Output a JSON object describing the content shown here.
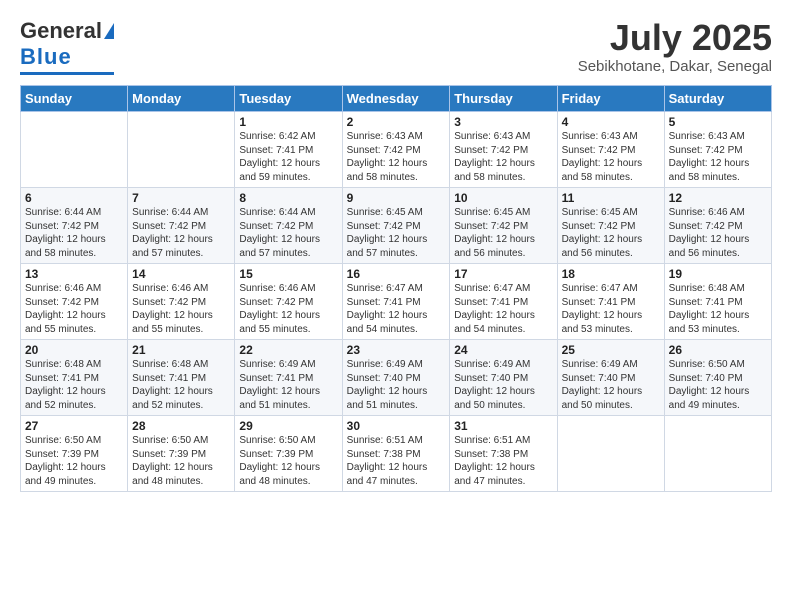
{
  "header": {
    "logo_general": "General",
    "logo_blue": "Blue",
    "month_title": "July 2025",
    "location": "Sebikhotane, Dakar, Senegal"
  },
  "days_of_week": [
    "Sunday",
    "Monday",
    "Tuesday",
    "Wednesday",
    "Thursday",
    "Friday",
    "Saturday"
  ],
  "weeks": [
    [
      {
        "day": "",
        "sunrise": "",
        "sunset": "",
        "daylight": ""
      },
      {
        "day": "",
        "sunrise": "",
        "sunset": "",
        "daylight": ""
      },
      {
        "day": "1",
        "sunrise": "Sunrise: 6:42 AM",
        "sunset": "Sunset: 7:41 PM",
        "daylight": "Daylight: 12 hours and 59 minutes."
      },
      {
        "day": "2",
        "sunrise": "Sunrise: 6:43 AM",
        "sunset": "Sunset: 7:42 PM",
        "daylight": "Daylight: 12 hours and 58 minutes."
      },
      {
        "day": "3",
        "sunrise": "Sunrise: 6:43 AM",
        "sunset": "Sunset: 7:42 PM",
        "daylight": "Daylight: 12 hours and 58 minutes."
      },
      {
        "day": "4",
        "sunrise": "Sunrise: 6:43 AM",
        "sunset": "Sunset: 7:42 PM",
        "daylight": "Daylight: 12 hours and 58 minutes."
      },
      {
        "day": "5",
        "sunrise": "Sunrise: 6:43 AM",
        "sunset": "Sunset: 7:42 PM",
        "daylight": "Daylight: 12 hours and 58 minutes."
      }
    ],
    [
      {
        "day": "6",
        "sunrise": "Sunrise: 6:44 AM",
        "sunset": "Sunset: 7:42 PM",
        "daylight": "Daylight: 12 hours and 58 minutes."
      },
      {
        "day": "7",
        "sunrise": "Sunrise: 6:44 AM",
        "sunset": "Sunset: 7:42 PM",
        "daylight": "Daylight: 12 hours and 57 minutes."
      },
      {
        "day": "8",
        "sunrise": "Sunrise: 6:44 AM",
        "sunset": "Sunset: 7:42 PM",
        "daylight": "Daylight: 12 hours and 57 minutes."
      },
      {
        "day": "9",
        "sunrise": "Sunrise: 6:45 AM",
        "sunset": "Sunset: 7:42 PM",
        "daylight": "Daylight: 12 hours and 57 minutes."
      },
      {
        "day": "10",
        "sunrise": "Sunrise: 6:45 AM",
        "sunset": "Sunset: 7:42 PM",
        "daylight": "Daylight: 12 hours and 56 minutes."
      },
      {
        "day": "11",
        "sunrise": "Sunrise: 6:45 AM",
        "sunset": "Sunset: 7:42 PM",
        "daylight": "Daylight: 12 hours and 56 minutes."
      },
      {
        "day": "12",
        "sunrise": "Sunrise: 6:46 AM",
        "sunset": "Sunset: 7:42 PM",
        "daylight": "Daylight: 12 hours and 56 minutes."
      }
    ],
    [
      {
        "day": "13",
        "sunrise": "Sunrise: 6:46 AM",
        "sunset": "Sunset: 7:42 PM",
        "daylight": "Daylight: 12 hours and 55 minutes."
      },
      {
        "day": "14",
        "sunrise": "Sunrise: 6:46 AM",
        "sunset": "Sunset: 7:42 PM",
        "daylight": "Daylight: 12 hours and 55 minutes."
      },
      {
        "day": "15",
        "sunrise": "Sunrise: 6:46 AM",
        "sunset": "Sunset: 7:42 PM",
        "daylight": "Daylight: 12 hours and 55 minutes."
      },
      {
        "day": "16",
        "sunrise": "Sunrise: 6:47 AM",
        "sunset": "Sunset: 7:41 PM",
        "daylight": "Daylight: 12 hours and 54 minutes."
      },
      {
        "day": "17",
        "sunrise": "Sunrise: 6:47 AM",
        "sunset": "Sunset: 7:41 PM",
        "daylight": "Daylight: 12 hours and 54 minutes."
      },
      {
        "day": "18",
        "sunrise": "Sunrise: 6:47 AM",
        "sunset": "Sunset: 7:41 PM",
        "daylight": "Daylight: 12 hours and 53 minutes."
      },
      {
        "day": "19",
        "sunrise": "Sunrise: 6:48 AM",
        "sunset": "Sunset: 7:41 PM",
        "daylight": "Daylight: 12 hours and 53 minutes."
      }
    ],
    [
      {
        "day": "20",
        "sunrise": "Sunrise: 6:48 AM",
        "sunset": "Sunset: 7:41 PM",
        "daylight": "Daylight: 12 hours and 52 minutes."
      },
      {
        "day": "21",
        "sunrise": "Sunrise: 6:48 AM",
        "sunset": "Sunset: 7:41 PM",
        "daylight": "Daylight: 12 hours and 52 minutes."
      },
      {
        "day": "22",
        "sunrise": "Sunrise: 6:49 AM",
        "sunset": "Sunset: 7:41 PM",
        "daylight": "Daylight: 12 hours and 51 minutes."
      },
      {
        "day": "23",
        "sunrise": "Sunrise: 6:49 AM",
        "sunset": "Sunset: 7:40 PM",
        "daylight": "Daylight: 12 hours and 51 minutes."
      },
      {
        "day": "24",
        "sunrise": "Sunrise: 6:49 AM",
        "sunset": "Sunset: 7:40 PM",
        "daylight": "Daylight: 12 hours and 50 minutes."
      },
      {
        "day": "25",
        "sunrise": "Sunrise: 6:49 AM",
        "sunset": "Sunset: 7:40 PM",
        "daylight": "Daylight: 12 hours and 50 minutes."
      },
      {
        "day": "26",
        "sunrise": "Sunrise: 6:50 AM",
        "sunset": "Sunset: 7:40 PM",
        "daylight": "Daylight: 12 hours and 49 minutes."
      }
    ],
    [
      {
        "day": "27",
        "sunrise": "Sunrise: 6:50 AM",
        "sunset": "Sunset: 7:39 PM",
        "daylight": "Daylight: 12 hours and 49 minutes."
      },
      {
        "day": "28",
        "sunrise": "Sunrise: 6:50 AM",
        "sunset": "Sunset: 7:39 PM",
        "daylight": "Daylight: 12 hours and 48 minutes."
      },
      {
        "day": "29",
        "sunrise": "Sunrise: 6:50 AM",
        "sunset": "Sunset: 7:39 PM",
        "daylight": "Daylight: 12 hours and 48 minutes."
      },
      {
        "day": "30",
        "sunrise": "Sunrise: 6:51 AM",
        "sunset": "Sunset: 7:38 PM",
        "daylight": "Daylight: 12 hours and 47 minutes."
      },
      {
        "day": "31",
        "sunrise": "Sunrise: 6:51 AM",
        "sunset": "Sunset: 7:38 PM",
        "daylight": "Daylight: 12 hours and 47 minutes."
      },
      {
        "day": "",
        "sunrise": "",
        "sunset": "",
        "daylight": ""
      },
      {
        "day": "",
        "sunrise": "",
        "sunset": "",
        "daylight": ""
      }
    ]
  ]
}
